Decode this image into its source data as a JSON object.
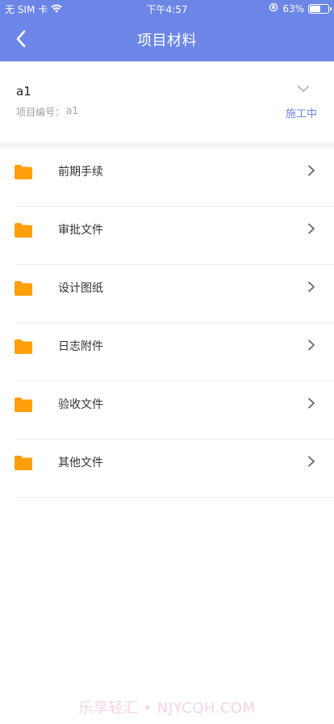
{
  "status_bar": {
    "carrier": "无 SIM 卡",
    "time": "下午4:57",
    "battery": "63%",
    "battery_level": 0.63
  },
  "header": {
    "title": "项目材料",
    "back_icon": "chevron-left-icon"
  },
  "project": {
    "name": "a1",
    "code_label": "项目编号：",
    "code": "a1",
    "status": "施工中",
    "dropdown_icon": "chevron-down-icon"
  },
  "folders": [
    {
      "label": "前期手续"
    },
    {
      "label": "审批文件"
    },
    {
      "label": "设计图纸"
    },
    {
      "label": "日志附件"
    },
    {
      "label": "验收文件"
    },
    {
      "label": "其他文件"
    }
  ],
  "colors": {
    "header_bg": "#6b86e6",
    "accent": "#6b86e6",
    "folder": "#ff9f0a"
  },
  "watermark": "乐享轻汇 • NJYCQH.COM"
}
